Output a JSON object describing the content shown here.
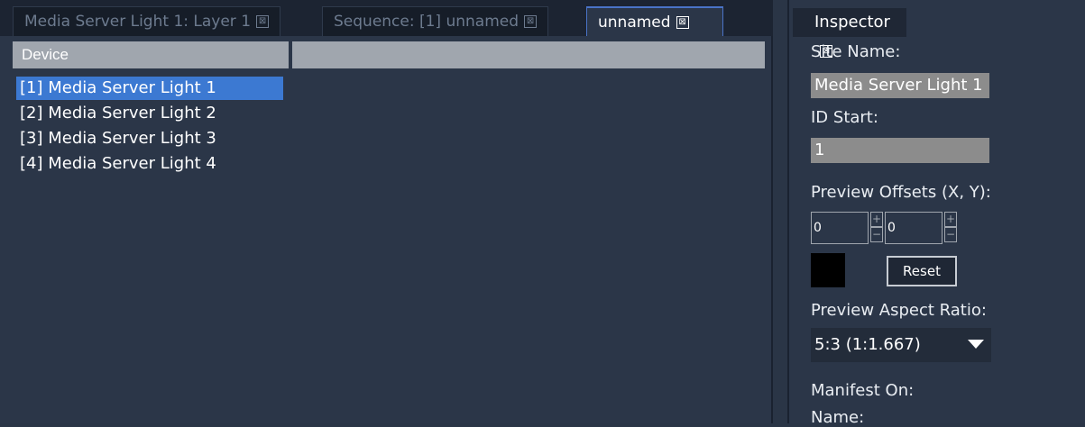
{
  "tabs": [
    {
      "label": "Media Server Light 1: Layer 1",
      "close": "⊠"
    },
    {
      "label": "Sequence: [1] unnamed",
      "close": "⊠"
    },
    {
      "label": "unnamed",
      "close": "⊠"
    }
  ],
  "device_list": {
    "column_header": "Device",
    "items": [
      "[1] Media Server Light 1",
      "[2] Media Server Light 2",
      "[3] Media Server Light 3",
      "[4] Media Server Light 4"
    ],
    "selected_index": 0
  },
  "inspector": {
    "tab_label": "Inspector",
    "tab_close": "⊠",
    "site_name_label": "Site Name:",
    "site_name_value": "Media Server Light 1",
    "id_start_label": "ID Start:",
    "id_start_value": "1",
    "preview_offsets_label": "Preview Offsets (X, Y):",
    "offset_x": "0",
    "offset_y": "0",
    "spin_up": "+",
    "spin_down": "−",
    "color_swatch": "#000000",
    "reset_label": "Reset",
    "aspect_label": "Preview Aspect Ratio:",
    "aspect_value": "5:3  (1:1.667)",
    "manifest_label": "Manifest On:",
    "name_label": "Name:"
  },
  "colors": {
    "background": "#2b3648",
    "selection": "#3c79d2",
    "active_tab_accent": "#4a73c7"
  }
}
